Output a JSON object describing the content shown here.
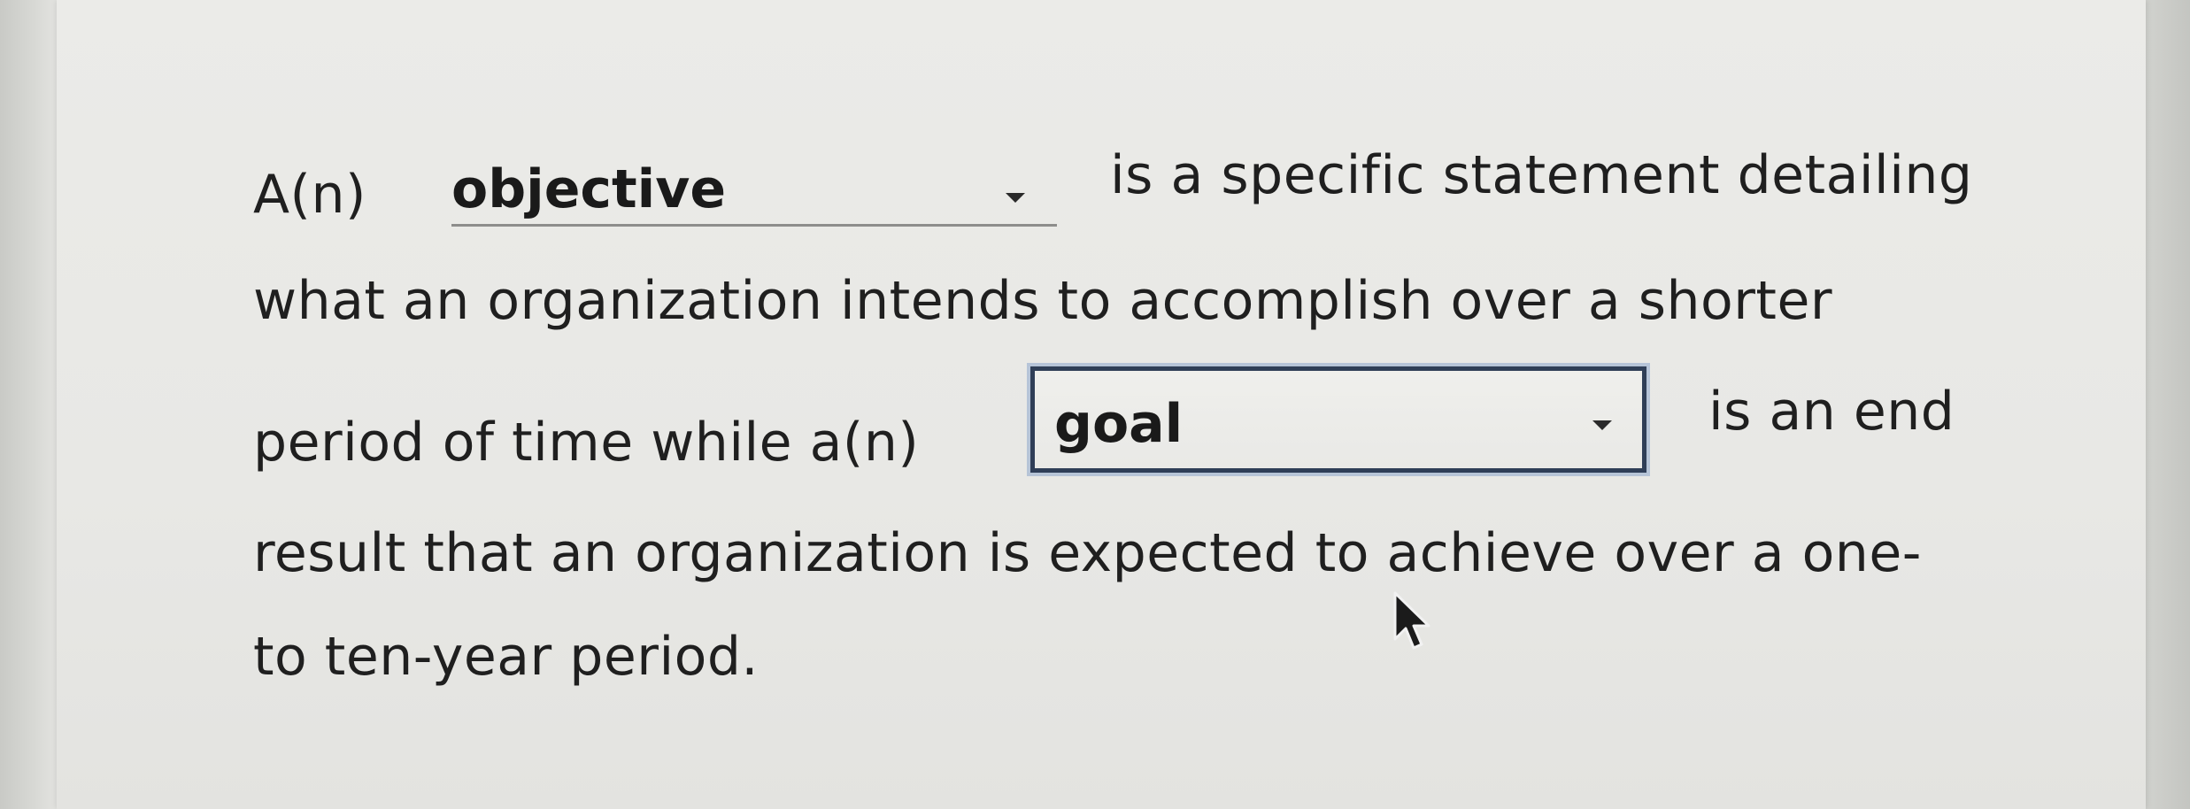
{
  "question": {
    "line1_prefix": "A(n)",
    "line1_suffix": "is a specific statement detailing",
    "line2": "what an organization intends to accomplish over a shorter",
    "line3_prefix": "period of time while a(n)",
    "line3_suffix": "is an end",
    "line4": "result that an organization is expected to achieve over a one-",
    "line5": "to ten-year period."
  },
  "dropdowns": {
    "first": {
      "selected": "objective"
    },
    "second": {
      "selected": "goal"
    }
  },
  "icons": {
    "dropdown_caret": "chevron-down-icon",
    "mouse_pointer": "mouse-pointer-icon"
  },
  "colors": {
    "focus_border": "#2f3e57",
    "text": "#1f1f1f"
  }
}
